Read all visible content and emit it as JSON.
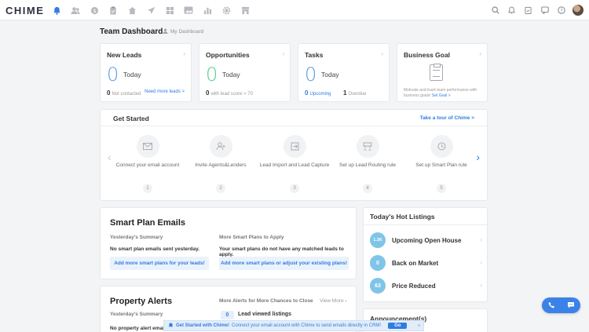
{
  "app": {
    "logo": "CHIME"
  },
  "topnav": {
    "icons": [
      "bell-icon",
      "users-icon",
      "dollar-icon",
      "clipboard-icon",
      "home-icon",
      "paper-plane-icon",
      "grid-icon",
      "image-icon",
      "bar-chart-icon",
      "gear-icon",
      "store-icon"
    ],
    "right_icons": [
      "search-icon",
      "notification-icon",
      "calendar-check-icon",
      "chat-icon",
      "help-icon"
    ]
  },
  "header": {
    "title": "Team Dashboard",
    "my_dashboard": "My Dashboard"
  },
  "cards": {
    "new_leads": {
      "title": "New Leads",
      "count": "0",
      "today": "Today",
      "stat_value": "0",
      "stat_label": "Not contacted",
      "link": "Need more leads >"
    },
    "opportunities": {
      "title": "Opportunities",
      "count": "0",
      "today": "Today",
      "stat_value": "0",
      "stat_label": "with lead score > 70"
    },
    "tasks": {
      "title": "Tasks",
      "count": "0",
      "today": "Today",
      "upcoming_value": "0",
      "upcoming_label": "Upcoming",
      "overdue_value": "1",
      "overdue_label": "Overdue"
    },
    "business_goal": {
      "title": "Business Goal",
      "desc": "Motivate and track team performance with business goals!",
      "link": "Set Goal >"
    }
  },
  "get_started": {
    "title": "Get Started",
    "link": "Take a tour of Chime >",
    "steps": [
      {
        "label": "Connect your email account",
        "num": "1"
      },
      {
        "label": "Invite Agents&Lenders",
        "num": "2"
      },
      {
        "label": "Lead Import and Lead Capture",
        "num": "3"
      },
      {
        "label": "Set up Lead Routing rule",
        "num": "4"
      },
      {
        "label": "Set up Smart Plan rule",
        "num": "5"
      }
    ]
  },
  "smart_plan": {
    "title": "Smart Plan Emails",
    "summary_head": "Yesterday's Summary",
    "summary_text": "No smart plan emails sent yesterday.",
    "more_head": "More Smart Plans to Apply",
    "more_text": "Your smart plans do not have any matched leads to apply.",
    "btn_left": "Add more smart plans for your leads!",
    "btn_right": "Add more smart plans or adjust your existing plans!"
  },
  "hot_listings": {
    "title": "Today's Hot Listings",
    "items": [
      {
        "badge": "1.3K",
        "label": "Upcoming Open House"
      },
      {
        "badge": "0",
        "label": "Back on Market"
      },
      {
        "badge": "63",
        "label": "Price Reduced"
      }
    ]
  },
  "announcements": {
    "title": "Announcement(s)"
  },
  "property_alerts": {
    "title": "Property Alerts",
    "more_head": "More Alerts for More Chances to Close",
    "view_more": "View More",
    "summary_head": "Yesterday's Summary",
    "summary_text": "No property alert emails",
    "lead_badge": "0",
    "lead_text": "Lead viewed listings"
  },
  "banner": {
    "bold": "Get Started with Chime!",
    "text": "Connect your email account with Chime to send emails directly in CRM!",
    "go": "Go",
    "close": "×"
  }
}
